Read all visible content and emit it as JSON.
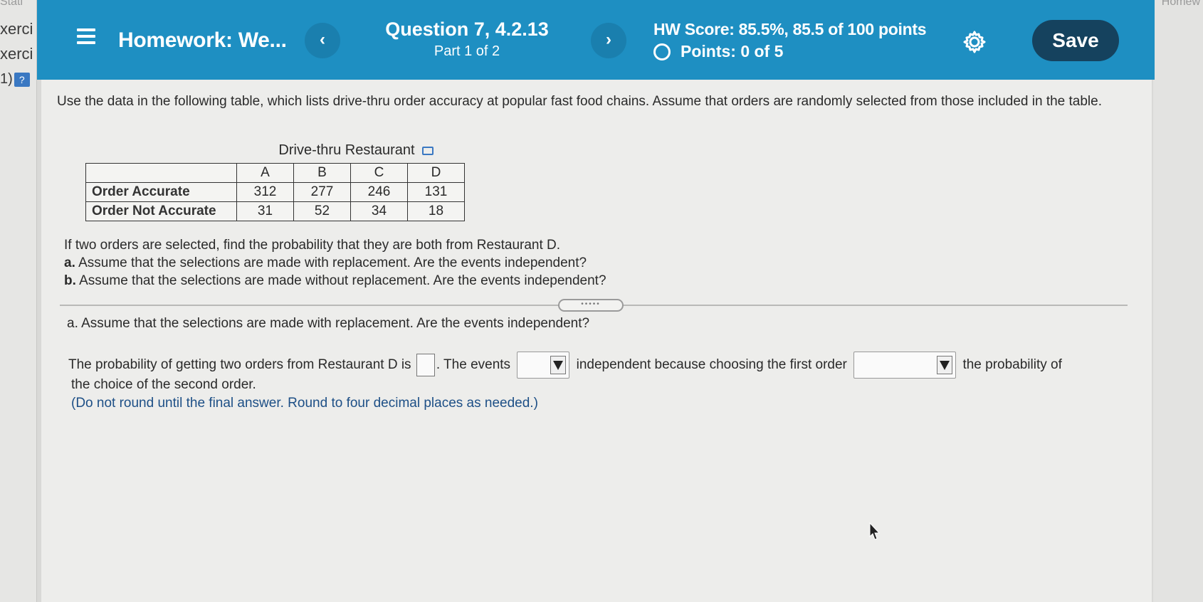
{
  "background": {
    "left_items": [
      "Stati",
      "xerci",
      "xerci",
      "1)"
    ],
    "right_label": "Homew"
  },
  "header": {
    "title": "Homework: We...",
    "question_title": "Question 7, 4.2.13",
    "part": "Part 1 of 2",
    "hw_score": "HW Score: 85.5%, 85.5 of 100 points",
    "points": "Points: 0 of 5",
    "save_label": "Save",
    "prev_glyph": "‹",
    "next_glyph": "›",
    "accent_color": "#1e8fc2"
  },
  "content": {
    "intro": "Use the data in the following table, which lists drive-thru order accuracy at popular fast food chains. Assume that orders are randomly selected from those included in the table.",
    "table": {
      "caption": "Drive-thru Restaurant",
      "columns": [
        "A",
        "B",
        "C",
        "D"
      ],
      "rows": [
        {
          "label": "Order Accurate",
          "values": [
            "312",
            "277",
            "246",
            "131"
          ]
        },
        {
          "label": "Order Not Accurate",
          "values": [
            "31",
            "52",
            "34",
            "18"
          ]
        }
      ]
    },
    "question": {
      "stem": "If two orders are selected, find the probability that they are both from Restaurant D.",
      "a_label": "a.",
      "a_text": "Assume that the selections are made with replacement. Are the events independent?",
      "b_label": "b.",
      "b_text": "Assume that the selections are made without replacement. Are the events independent?"
    },
    "part_a_heading": "a. Assume that the selections are made with replacement. Are the events independent?",
    "answer": {
      "text1": "The probability of getting two orders from Restaurant D is",
      "text2": ". The events",
      "text3": "independent because choosing the first order",
      "text4": "the probability of",
      "text5": "the choice of the second order.",
      "note": "(Do not round until the final answer. Round to four decimal places as needed.)"
    }
  }
}
